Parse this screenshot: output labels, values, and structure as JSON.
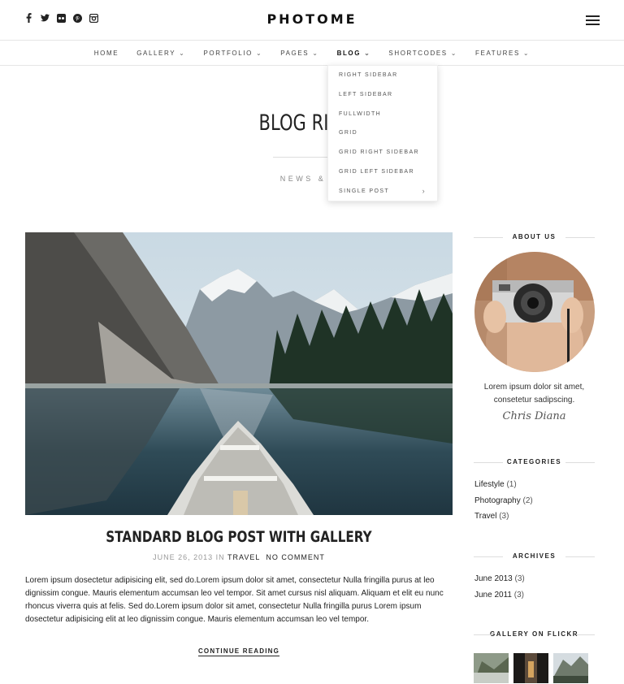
{
  "header": {
    "logo": "PHOTOME",
    "social_icons": [
      "facebook-icon",
      "twitter-icon",
      "flickr-icon",
      "pinterest-icon",
      "instagram-icon"
    ]
  },
  "nav": {
    "items": [
      {
        "label": "HOME",
        "has_caret": false
      },
      {
        "label": "GALLERY",
        "has_caret": true
      },
      {
        "label": "PORTFOLIO",
        "has_caret": true
      },
      {
        "label": "PAGES",
        "has_caret": true
      },
      {
        "label": "BLOG",
        "has_caret": true,
        "active": true
      },
      {
        "label": "SHORTCODES",
        "has_caret": true
      },
      {
        "label": "FEATURES",
        "has_caret": true
      }
    ]
  },
  "dropdown": {
    "items": [
      "RIGHT SIDEBAR",
      "LEFT SIDEBAR",
      "FULLWIDTH",
      "GRID",
      "GRID RIGHT SIDEBAR",
      "GRID LEFT SIDEBAR",
      "SINGLE POST"
    ],
    "submenu_arrow": "›"
  },
  "page": {
    "title": "BLOG RIGHT",
    "subtitle": "NEWS & ID"
  },
  "post": {
    "title": "STANDARD BLOG POST WITH GALLERY",
    "date": "JUNE 26, 2013",
    "in_word": "IN",
    "category": "TRAVEL",
    "comments": "NO COMMENT",
    "excerpt": "Lorem ipsum dosectetur adipisicing elit, sed do.Lorem ipsum dolor sit amet, consectetur Nulla fringilla purus at leo dignissim congue. Mauris elementum accumsan leo vel tempor. Sit amet cursus nisl aliquam. Aliquam et elit eu nunc rhoncus viverra quis at felis. Sed do.Lorem ipsum dolor sit amet, consectetur Nulla fringilla purus Lorem ipsum dosectetur adipisicing elit at leo dignissim congue. Mauris elementum accumsan leo vel tempor.",
    "continue_label": "CONTINUE READING"
  },
  "sidebar": {
    "about": {
      "title": "ABOUT US",
      "text_line1": "Lorem ipsum dolor sit amet,",
      "text_line2": "consetetur sadipscing.",
      "signature": "Chris Diana"
    },
    "categories": {
      "title": "CATEGORIES",
      "items": [
        {
          "label": "Lifestyle",
          "count": "(1)"
        },
        {
          "label": "Photography",
          "count": "(2)"
        },
        {
          "label": "Travel",
          "count": "(3)"
        }
      ]
    },
    "archives": {
      "title": "ARCHIVES",
      "items": [
        {
          "label": "June 2013",
          "count": "(3)"
        },
        {
          "label": "June 2011",
          "count": "(3)"
        }
      ]
    },
    "flickr": {
      "title": "GALLERY ON FLICKR"
    }
  }
}
